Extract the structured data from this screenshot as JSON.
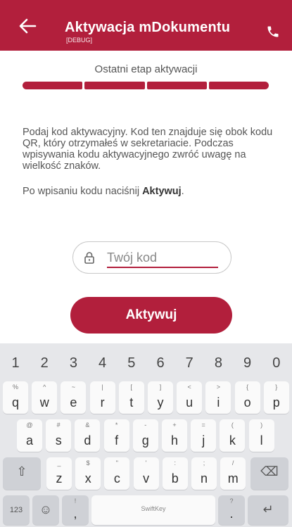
{
  "appbar": {
    "title": "Aktywacja mDokumentu",
    "subtitle": "[DEBUG]",
    "back_icon": "arrow-left-icon",
    "phone_icon": "phone-icon"
  },
  "stage_label": "Ostatni etap aktywacji",
  "progress": {
    "segments_total": 4,
    "segments_completed": 4
  },
  "instructions": "Podaj kod aktywacyjny. Kod ten znajduje się obok kodu QR, który otrzymałeś w sekretariacie. Podczas wpisywania kodu aktywacyjnego zwróć uwagę na wielkość znaków.",
  "hint": {
    "prefix": "Po wpisaniu kodu naciśnij ",
    "bold": "Aktywuj",
    "suffix": "."
  },
  "code_field": {
    "placeholder": "Twój kod",
    "value": ""
  },
  "activate_label": "Aktywuj",
  "colors": {
    "accent": "#b21f3c",
    "keyboard_bg": "#e6e7ea"
  },
  "keyboard": {
    "numbers": [
      "1",
      "2",
      "3",
      "4",
      "5",
      "6",
      "7",
      "8",
      "9",
      "0"
    ],
    "row1": [
      [
        "%",
        "q"
      ],
      [
        "^",
        "w"
      ],
      [
        "~",
        "e"
      ],
      [
        "|",
        "r"
      ],
      [
        "[",
        "t"
      ],
      [
        "]",
        "y"
      ],
      [
        "<",
        "u"
      ],
      [
        ">",
        "i"
      ],
      [
        "{",
        "o"
      ],
      [
        "}",
        "p"
      ]
    ],
    "row2": [
      [
        "@",
        "a"
      ],
      [
        "#",
        "s"
      ],
      [
        "&",
        "d"
      ],
      [
        "*",
        "f"
      ],
      [
        "-",
        "g"
      ],
      [
        "+",
        "h"
      ],
      [
        "=",
        "j"
      ],
      [
        "(",
        "k"
      ],
      [
        ")",
        "l"
      ]
    ],
    "row3": [
      [
        "_",
        "z"
      ],
      [
        "$",
        "x"
      ],
      [
        "\"",
        "c"
      ],
      [
        "'",
        "v"
      ],
      [
        ":",
        "b"
      ],
      [
        ";",
        "n"
      ],
      [
        "/",
        "m"
      ]
    ],
    "shift_icon": "shift-arrow-icon",
    "backspace_icon": "backspace-icon",
    "bottom": {
      "num_label": "123",
      "emoji_icon": "emoji-icon",
      "comma_sub": "!",
      "comma": ",",
      "space_brand": "SwiftKey",
      "period_sub": "?",
      "period": ".",
      "enter_icon": "enter-icon"
    }
  }
}
